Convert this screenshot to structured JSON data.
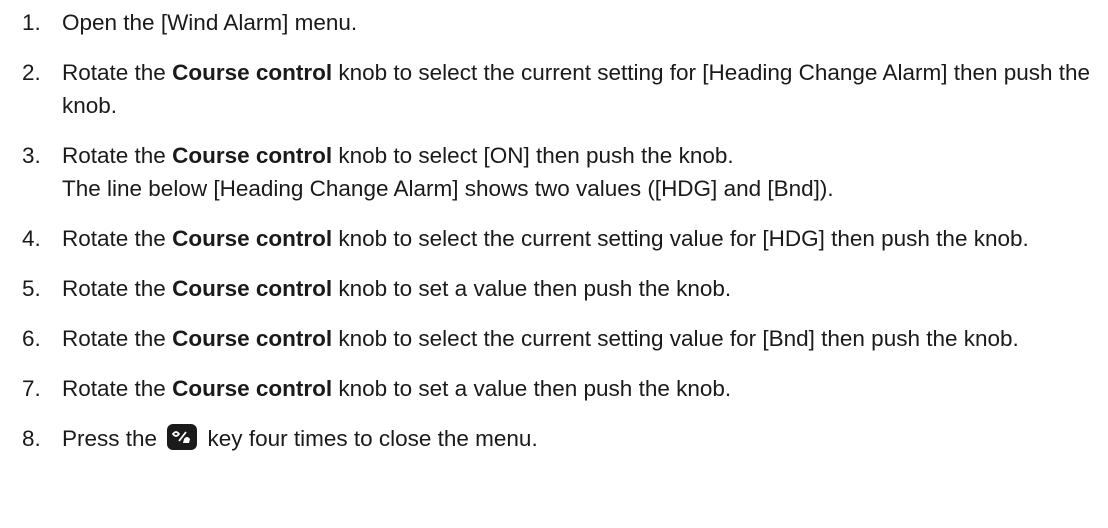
{
  "steps": [
    {
      "number": "1.",
      "text": "Open the [Wind Alarm] menu."
    },
    {
      "number": "2.",
      "before": "Rotate the ",
      "bold": "Course control",
      "after": " knob to select the current setting for [Heading Change Alarm] then push the knob."
    },
    {
      "number": "3.",
      "before": "Rotate the ",
      "bold": "Course control",
      "after": " knob to select [ON] then push the knob.",
      "note": "The line below [Heading Change Alarm] shows two values ([HDG] and [Bnd])."
    },
    {
      "number": "4.",
      "before": "Rotate the ",
      "bold": "Course control",
      "after": " knob to select the current setting value for [HDG] then push the knob."
    },
    {
      "number": "5.",
      "before": "Rotate the ",
      "bold": "Course control",
      "after": " knob to set a value then push the knob."
    },
    {
      "number": "6.",
      "before": "Rotate the ",
      "bold": "Course control",
      "after": " knob to select the current setting value for [Bnd] then push the knob."
    },
    {
      "number": "7.",
      "before": "Rotate the ",
      "bold": "Course control",
      "after": " knob to set a value then push the knob."
    },
    {
      "number": "8.",
      "before": "Press the ",
      "icon": "menu-key-icon",
      "after": " key four times to close the menu."
    }
  ]
}
